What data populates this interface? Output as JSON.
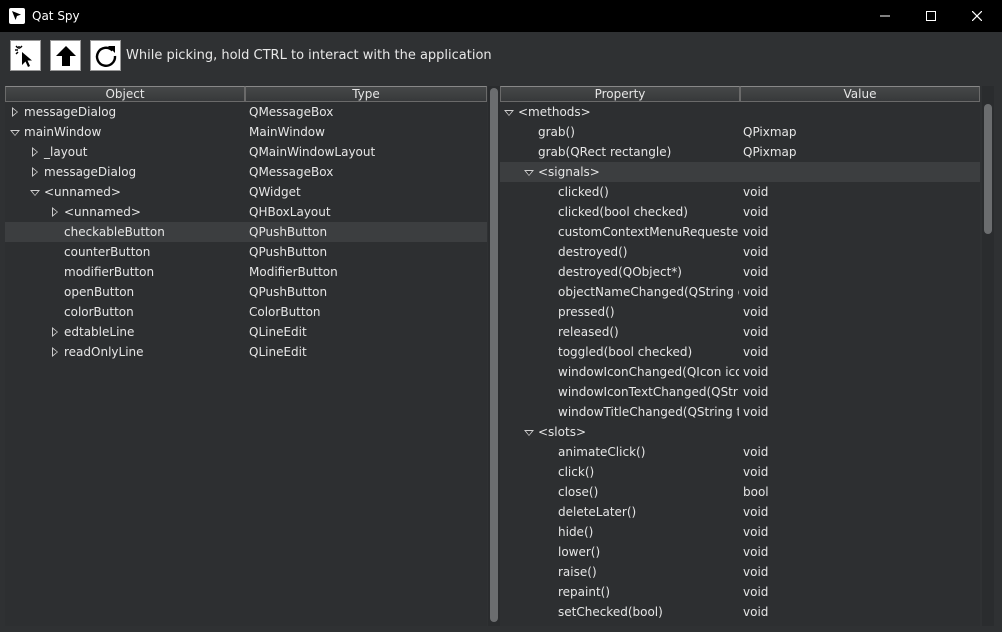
{
  "window": {
    "title": "Qat Spy"
  },
  "toolbar": {
    "pick_icon": "pick-cursor-icon",
    "up_icon": "up-arrow-icon",
    "refresh_icon": "refresh-icon",
    "hint": "While picking, hold CTRL to interact with the application"
  },
  "object_tree": {
    "headers": [
      "Object",
      "Type"
    ],
    "rows": [
      {
        "depth": 0,
        "expander": "right",
        "name": "messageDialog",
        "type": "QMessageBox"
      },
      {
        "depth": 0,
        "expander": "down",
        "name": "mainWindow",
        "type": "MainWindow"
      },
      {
        "depth": 1,
        "expander": "right",
        "name": "_layout",
        "type": "QMainWindowLayout"
      },
      {
        "depth": 1,
        "expander": "right",
        "name": "messageDialog",
        "type": "QMessageBox"
      },
      {
        "depth": 1,
        "expander": "down",
        "name": "<unnamed>",
        "type": "QWidget"
      },
      {
        "depth": 2,
        "expander": "right",
        "name": "<unnamed>",
        "type": "QHBoxLayout"
      },
      {
        "depth": 2,
        "expander": "none",
        "name": "checkableButton",
        "type": "QPushButton",
        "selected": true
      },
      {
        "depth": 2,
        "expander": "none",
        "name": "counterButton",
        "type": "QPushButton"
      },
      {
        "depth": 2,
        "expander": "none",
        "name": "modifierButton",
        "type": "ModifierButton"
      },
      {
        "depth": 2,
        "expander": "none",
        "name": "openButton",
        "type": "QPushButton"
      },
      {
        "depth": 2,
        "expander": "none",
        "name": "colorButton",
        "type": "ColorButton"
      },
      {
        "depth": 2,
        "expander": "right",
        "name": "edtableLine",
        "type": "QLineEdit"
      },
      {
        "depth": 2,
        "expander": "right",
        "name": "readOnlyLine",
        "type": "QLineEdit"
      }
    ]
  },
  "property_tree": {
    "headers": [
      "Property",
      "Value"
    ],
    "rows": [
      {
        "depth": 0,
        "expander": "down",
        "name": "<methods>",
        "value": ""
      },
      {
        "depth": 1,
        "expander": "none",
        "name": "grab()",
        "value": "QPixmap"
      },
      {
        "depth": 1,
        "expander": "none",
        "name": "grab(QRect rectangle)",
        "value": "QPixmap"
      },
      {
        "depth": 1,
        "expander": "down",
        "name": "<signals>",
        "value": "",
        "selected": true
      },
      {
        "depth": 2,
        "expander": "none",
        "name": "clicked()",
        "value": "void"
      },
      {
        "depth": 2,
        "expander": "none",
        "name": "clicked(bool checked)",
        "value": "void"
      },
      {
        "depth": 2,
        "expander": "none",
        "name": "customContextMenuRequested(Q",
        "value": "void"
      },
      {
        "depth": 2,
        "expander": "none",
        "name": "destroyed()",
        "value": "void"
      },
      {
        "depth": 2,
        "expander": "none",
        "name": "destroyed(QObject*)",
        "value": "void"
      },
      {
        "depth": 2,
        "expander": "none",
        "name": "objectNameChanged(QString obje",
        "value": "void"
      },
      {
        "depth": 2,
        "expander": "none",
        "name": "pressed()",
        "value": "void"
      },
      {
        "depth": 2,
        "expander": "none",
        "name": "released()",
        "value": "void"
      },
      {
        "depth": 2,
        "expander": "none",
        "name": "toggled(bool checked)",
        "value": "void"
      },
      {
        "depth": 2,
        "expander": "none",
        "name": "windowIconChanged(QIcon icon)",
        "value": "void"
      },
      {
        "depth": 2,
        "expander": "none",
        "name": "windowIconTextChanged(QString",
        "value": "void"
      },
      {
        "depth": 2,
        "expander": "none",
        "name": "windowTitleChanged(QString title)",
        "value": "void"
      },
      {
        "depth": 1,
        "expander": "down",
        "name": "<slots>",
        "value": ""
      },
      {
        "depth": 2,
        "expander": "none",
        "name": "animateClick()",
        "value": "void"
      },
      {
        "depth": 2,
        "expander": "none",
        "name": "click()",
        "value": "void"
      },
      {
        "depth": 2,
        "expander": "none",
        "name": "close()",
        "value": "bool"
      },
      {
        "depth": 2,
        "expander": "none",
        "name": "deleteLater()",
        "value": "void"
      },
      {
        "depth": 2,
        "expander": "none",
        "name": "hide()",
        "value": "void"
      },
      {
        "depth": 2,
        "expander": "none",
        "name": "lower()",
        "value": "void"
      },
      {
        "depth": 2,
        "expander": "none",
        "name": "raise()",
        "value": "void"
      },
      {
        "depth": 2,
        "expander": "none",
        "name": "repaint()",
        "value": "void"
      },
      {
        "depth": 2,
        "expander": "none",
        "name": "setChecked(bool)",
        "value": "void"
      }
    ]
  }
}
